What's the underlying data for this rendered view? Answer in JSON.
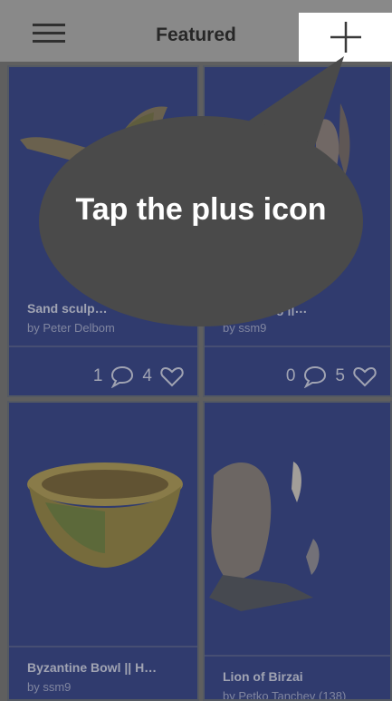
{
  "header": {
    "title": "Featured",
    "menu_icon": "hamburger-icon",
    "add_icon": "plus-icon"
  },
  "cards": [
    {
      "name": "Sand sculp…",
      "author": "by Peter Delbom",
      "comments": "1",
      "likes": "4"
    },
    {
      "name": "…hed Jug ||…",
      "author": "by ssm9",
      "comments": "0",
      "likes": "5"
    },
    {
      "name": "Byzantine Bowl || H…",
      "author": "by ssm9"
    },
    {
      "name": "Lion of Birzai",
      "author": "by Petko Tanchev (138)"
    }
  ],
  "tooltip": {
    "text": "Tap the plus icon"
  },
  "colors": {
    "card_bg": "#2b3b82",
    "overlay": "#4a4a4a",
    "topbar": "#a7a7a7"
  }
}
